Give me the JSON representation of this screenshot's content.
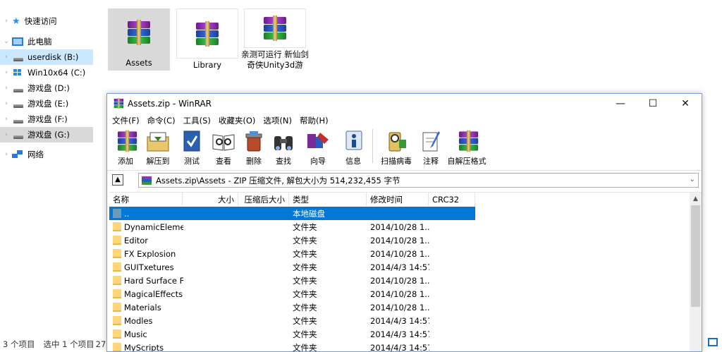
{
  "explorer": {
    "nav": [
      {
        "label": "快速访问",
        "icon": "star-icon"
      },
      {
        "label": "此电脑",
        "icon": "computer-icon"
      },
      {
        "label": "userdisk (B:)",
        "icon": "drive-icon"
      },
      {
        "label": "Win10x64 (C:)",
        "icon": "windows-drive-icon"
      },
      {
        "label": "游戏盘 (D:)",
        "icon": "drive-icon"
      },
      {
        "label": "游戏盘 (E:)",
        "icon": "drive-icon"
      },
      {
        "label": "游戏盘 (F:)",
        "icon": "drive-icon"
      },
      {
        "label": "游戏盘 (G:)",
        "icon": "drive-icon"
      },
      {
        "label": "网络",
        "icon": "network-icon"
      }
    ],
    "files": [
      {
        "name": "Assets"
      },
      {
        "name": "Library"
      },
      {
        "name": "亲测可运行 新仙剑奇侠Unity3d游"
      }
    ],
    "status": {
      "count": "3 个项目",
      "selected": "选中 1 个项目",
      "size": "27"
    }
  },
  "winrar": {
    "title": "Assets.zip - WinRAR",
    "controls": {
      "minimize": "—",
      "maximize": "☐",
      "close": "✕"
    },
    "menu": [
      "文件(F)",
      "命令(C)",
      "工具(S)",
      "收藏夹(O)",
      "选项(N)",
      "帮助(H)"
    ],
    "toolbar": [
      "添加",
      "解压到",
      "测试",
      "查看",
      "删除",
      "查找",
      "向导",
      "信息",
      "扫描病毒",
      "注释",
      "自解压格式"
    ],
    "path": "Assets.zip\\Assets - ZIP 压缩文件, 解包大小为 514,232,455 字节",
    "columns": [
      "名称",
      "大小",
      "压缩后大小",
      "类型",
      "修改时间",
      "CRC32"
    ],
    "rows": [
      {
        "name": "..",
        "size": "",
        "packed": "",
        "type": "本地磁盘",
        "modified": "",
        "crc": ""
      },
      {
        "name": "DynamicEleme...",
        "size": "",
        "packed": "",
        "type": "文件夹",
        "modified": "2014/10/28 1...",
        "crc": ""
      },
      {
        "name": "Editor",
        "size": "",
        "packed": "",
        "type": "文件夹",
        "modified": "2014/10/28 1...",
        "crc": ""
      },
      {
        "name": "FX Explosion",
        "size": "",
        "packed": "",
        "type": "文件夹",
        "modified": "2014/10/28 1...",
        "crc": ""
      },
      {
        "name": "GUITxetures",
        "size": "",
        "packed": "",
        "type": "文件夹",
        "modified": "2014/4/3 14:57",
        "crc": ""
      },
      {
        "name": "Hard Surface F...",
        "size": "",
        "packed": "",
        "type": "文件夹",
        "modified": "2014/10/28 1...",
        "crc": ""
      },
      {
        "name": "MagicalEffects",
        "size": "",
        "packed": "",
        "type": "文件夹",
        "modified": "2014/10/28 1...",
        "crc": ""
      },
      {
        "name": "Materials",
        "size": "",
        "packed": "",
        "type": "文件夹",
        "modified": "2014/10/28 1...",
        "crc": ""
      },
      {
        "name": "Modles",
        "size": "",
        "packed": "",
        "type": "文件夹",
        "modified": "2014/4/3 14:57",
        "crc": ""
      },
      {
        "name": "Music",
        "size": "",
        "packed": "",
        "type": "文件夹",
        "modified": "2014/4/3 14:57",
        "crc": ""
      },
      {
        "name": "MyScripts",
        "size": "",
        "packed": "",
        "type": "文件夹",
        "modified": "2014/4/3 14:57",
        "crc": ""
      }
    ]
  },
  "colors": {
    "selection": "#0078d7",
    "explorer_selection": "#cce8ff",
    "folder": "#ffd77a"
  }
}
